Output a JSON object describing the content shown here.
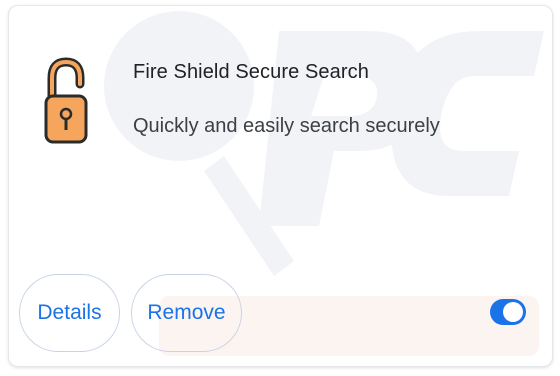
{
  "extension": {
    "name": "Fire Shield Secure Search",
    "description": "Quickly and easily search securely",
    "icon": "padlock-unlocked-icon"
  },
  "actions": {
    "details_label": "Details",
    "remove_label": "Remove"
  },
  "toggle": {
    "enabled": true
  },
  "colors": {
    "accent": "#1a73e8",
    "icon_fill": "#f5a55c",
    "icon_outline": "#2b2b2b",
    "watermark": "#e5e8ee"
  }
}
